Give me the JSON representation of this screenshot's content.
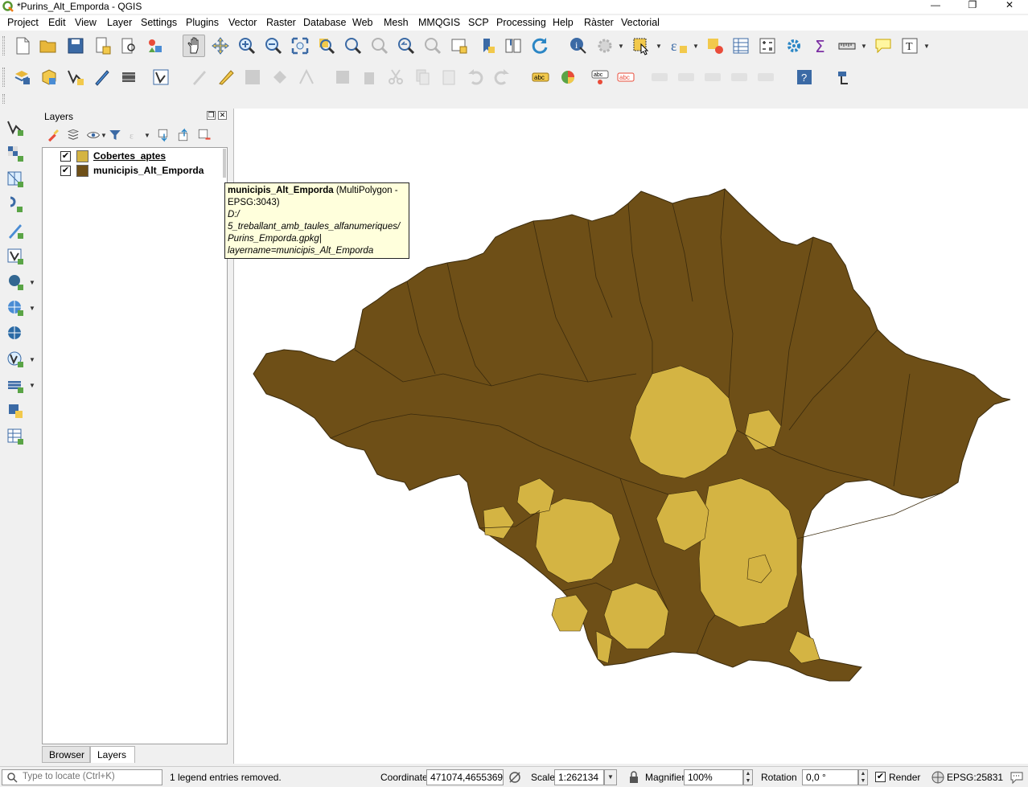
{
  "window": {
    "title": "*Purins_Alt_Emporda - QGIS",
    "minimize": "—",
    "maximize": "❐",
    "close": "✕"
  },
  "menu": [
    "Project",
    "Edit",
    "View",
    "Layer",
    "Settings",
    "Plugins",
    "Vector",
    "Raster",
    "Database",
    "Web",
    "Mesh",
    "MMQGIS",
    "SCP",
    "Processing",
    "Help",
    "Ràster",
    "Vectorial"
  ],
  "layers_panel": {
    "title": "Layers",
    "layers": [
      {
        "name": "Cobertes_aptes",
        "checked": true,
        "color": "#d4b443"
      },
      {
        "name": "municipis_Alt_Emporda",
        "checked": true,
        "color": "#6e4f17"
      }
    ],
    "tabs": [
      "Browser",
      "Layers"
    ],
    "active_tab": "Layers"
  },
  "tooltip": {
    "layer_name": "municipis_Alt_Emporda",
    "type_line1": " (MultiPolygon -",
    "type_line2": "EPSG:3043)",
    "path_lines": [
      "D:/",
      "5_treballant_amb_taules_alfanumeriques/",
      "Purins_Emporda.gpkg|",
      "layername=municipis_Alt_Emporda"
    ]
  },
  "map": {
    "fill_dark": "#6e4f17",
    "fill_light": "#d4b443",
    "stroke": "#3a2a0c"
  },
  "status": {
    "locator_placeholder": "Type to locate (Ctrl+K)",
    "message": "1 legend entries removed.",
    "coordinate_label": "Coordinate",
    "coordinate_value": "471074,4655369",
    "scale_label": "Scale",
    "scale_value": "1:262134",
    "magnifier_label": "Magnifier",
    "magnifier_value": "100%",
    "rotation_label": "Rotation",
    "rotation_value": "0,0 °",
    "render_label": "Render",
    "render_checked": true,
    "crs": "EPSG:25831"
  }
}
